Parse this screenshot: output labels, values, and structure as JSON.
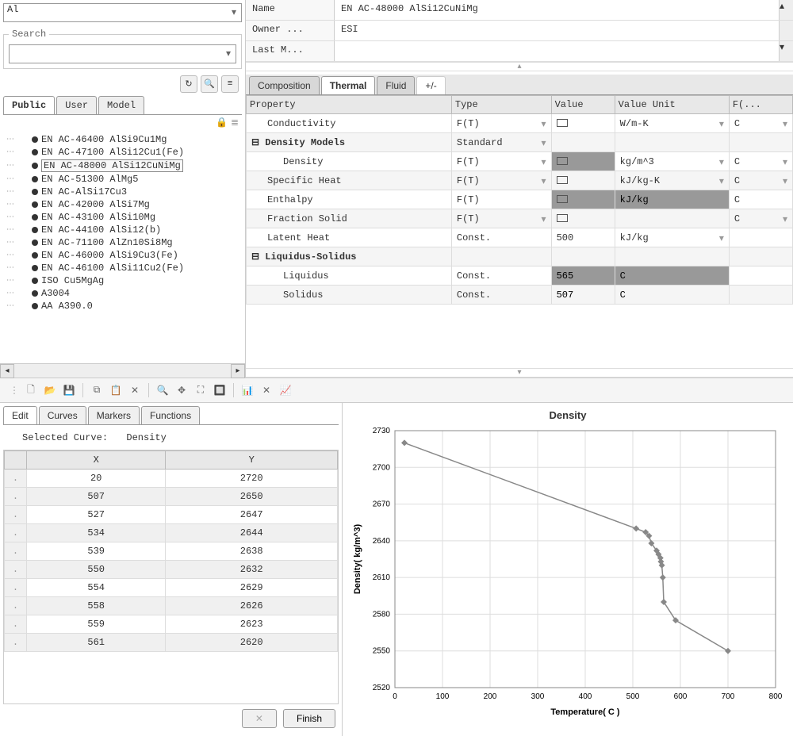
{
  "left": {
    "type_value": "Al",
    "search_label": "Search",
    "tabs": [
      "Public",
      "User",
      "Model"
    ],
    "active_tab": 0,
    "tree_items": [
      {
        "label": "EN AC-46400 AlSi9Cu1Mg",
        "selected": false
      },
      {
        "label": "EN AC-47100 AlSi12Cu1(Fe)",
        "selected": false
      },
      {
        "label": "EN AC-48000 AlSi12CuNiMg",
        "selected": true
      },
      {
        "label": "EN AC-51300 AlMg5",
        "selected": false
      },
      {
        "label": "EN AC-AlSi17Cu3",
        "selected": false
      },
      {
        "label": "EN AC-42000 AlSi7Mg",
        "selected": false
      },
      {
        "label": "EN AC-43100 AlSi10Mg",
        "selected": false
      },
      {
        "label": "EN AC-44100 AlSi12(b)",
        "selected": false
      },
      {
        "label": "EN AC-71100 AlZn10Si8Mg",
        "selected": false
      },
      {
        "label": "EN AC-46000 AlSi9Cu3(Fe)",
        "selected": false
      },
      {
        "label": "EN AC-46100 AlSi11Cu2(Fe)",
        "selected": false
      },
      {
        "label": "ISO Cu5MgAg",
        "selected": false
      },
      {
        "label": "A3004",
        "selected": false
      },
      {
        "label": "AA A390.0",
        "selected": false
      }
    ]
  },
  "header": {
    "rows": [
      {
        "label": "Name",
        "value": "EN AC-48000 AlSi12CuNiMg"
      },
      {
        "label": "Owner ...",
        "value": "ESI"
      },
      {
        "label": "Last M...",
        "value": ""
      }
    ]
  },
  "props": {
    "tabs": [
      "Composition",
      "Thermal",
      "Fluid"
    ],
    "active_tab": 1,
    "plus": "+/-",
    "columns": [
      "Property",
      "Type",
      "Value",
      "Value Unit",
      "F(..."
    ],
    "rows": [
      {
        "name": "Conductivity",
        "type": "F(T)",
        "value_icon": true,
        "unit": "W/m-K",
        "funit": "C",
        "indent": 1,
        "type_dd": true,
        "unit_dd": true,
        "fu_dd": true
      },
      {
        "name": "Density Models",
        "type": "Standard",
        "bold": true,
        "group": true,
        "type_dd": true
      },
      {
        "name": "Density",
        "type": "F(T)",
        "value_icon": true,
        "unit": "kg/m^3",
        "funit": "C",
        "indent": 2,
        "type_dd": true,
        "unit_dd": true,
        "fu_dd": true,
        "value_hl": true
      },
      {
        "name": "Specific Heat",
        "type": "F(T)",
        "value_icon": true,
        "unit": "kJ/kg-K",
        "funit": "C",
        "indent": 1,
        "type_dd": true,
        "unit_dd": true,
        "fu_dd": true
      },
      {
        "name": "Enthalpy",
        "type": "F(T)",
        "value_icon": true,
        "unit": "kJ/kg",
        "funit": "C",
        "indent": 1,
        "row_hl": true
      },
      {
        "name": "Fraction Solid",
        "type": "F(T)",
        "value_icon": true,
        "unit": "",
        "funit": "C",
        "indent": 1,
        "type_dd": true,
        "fu_dd": true
      },
      {
        "name": "Latent Heat",
        "type": "Const.",
        "value": "500",
        "unit": "kJ/kg",
        "funit": "",
        "indent": 1,
        "unit_dd": true
      },
      {
        "name": "Liquidus-Solidus",
        "bold": true,
        "group": true
      },
      {
        "name": "Liquidus",
        "type": "Const.",
        "value": "565",
        "unit": "C",
        "indent": 2,
        "val_unit_hl": true
      },
      {
        "name": "Solidus",
        "type": "Const.",
        "value": "507",
        "unit": "C",
        "indent": 2,
        "val_unit_hl": true
      }
    ]
  },
  "editor": {
    "tabs": [
      "Edit",
      "Curves",
      "Markers",
      "Functions"
    ],
    "active_tab": 0,
    "selected_curve_label": "Selected Curve:",
    "selected_curve": "Density",
    "columns": [
      "X",
      "Y"
    ],
    "rows": [
      {
        "x": "20",
        "y": "2720"
      },
      {
        "x": "507",
        "y": "2650"
      },
      {
        "x": "527",
        "y": "2647"
      },
      {
        "x": "534",
        "y": "2644"
      },
      {
        "x": "539",
        "y": "2638"
      },
      {
        "x": "550",
        "y": "2632"
      },
      {
        "x": "554",
        "y": "2629"
      },
      {
        "x": "558",
        "y": "2626"
      },
      {
        "x": "559",
        "y": "2623"
      },
      {
        "x": "561",
        "y": "2620"
      }
    ],
    "cancel_label": "✕",
    "finish_label": "Finish"
  },
  "chart_data": {
    "type": "line",
    "title": "Density",
    "xlabel": "Temperature( C )",
    "ylabel": "Density( kg/m^3)",
    "xlim": [
      0,
      800
    ],
    "ylim": [
      2520,
      2730
    ],
    "x": [
      20,
      507,
      527,
      534,
      539,
      550,
      554,
      558,
      559,
      561,
      563,
      565,
      590,
      700
    ],
    "y": [
      2720,
      2650,
      2647,
      2644,
      2638,
      2632,
      2629,
      2626,
      2623,
      2620,
      2610,
      2590,
      2575,
      2550
    ],
    "xticks": [
      0,
      100,
      200,
      300,
      400,
      500,
      600,
      700,
      800
    ],
    "yticks": [
      2520,
      2550,
      2580,
      2610,
      2640,
      2670,
      2700,
      2730
    ]
  }
}
